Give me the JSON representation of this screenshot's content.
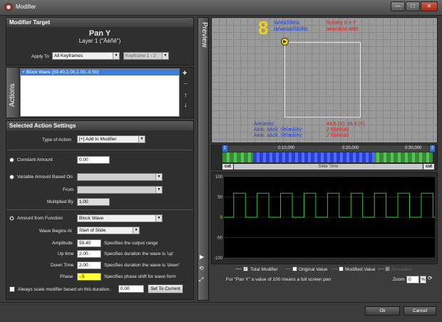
{
  "window": {
    "title": "Modifier",
    "minimize": "—",
    "maximize": "□",
    "close": "✕"
  },
  "modifier_target": {
    "header": "Modifier Target",
    "title": "Pan Y",
    "subtitle": "Layer 1 (\"Äéñê\")",
    "apply_to_label": "Apply To",
    "apply_to_value": "All Keyframes",
    "keyframe_value": "Keyframe 1 - 2"
  },
  "actions": {
    "tab_label": "Actions",
    "items": [
      "+ Block Wave (59.40,2.00,2.00,-0.50)"
    ],
    "add": "+",
    "remove": "−",
    "up": "↑",
    "down": "↓"
  },
  "settings": {
    "header": "Selected Action Settings",
    "type_label": "Type of Action",
    "type_value": "[+] Add to Modifier",
    "constant_label": "Constant Amount",
    "constant_value": "0.00",
    "variable_label": "Variable Amount Based On",
    "variable_value": "",
    "from_label": "From",
    "from_value": "",
    "multiplied_label": "Multiplied By",
    "multiplied_value": "1.00",
    "function_label": "Amount from Function",
    "function_value": "Block Wave",
    "wave_begins_label": "Wave Begins At",
    "wave_begins_value": "Start of Slide",
    "amplitude_label": "Amplitude",
    "amplitude_value": "59.40",
    "amplitude_desc": "Specifies the output range",
    "uptime_label": "Up time",
    "uptime_value": "2.00",
    "uptime_desc": "Specifies duration the wave is 'up'",
    "downtime_label": "Down Time",
    "downtime_value": "2.00",
    "downtime_desc": "Specifies duration the wave is 'down'",
    "phase_label": "Phase",
    "phase_value": "-.5",
    "phase_desc": "Specifies phase shift for wave form",
    "always_scale_label": "Always scale modifier based on this duration.",
    "always_scale_value": "0.00",
    "set_current": "Set To Current"
  },
  "preview": {
    "tab_label": "Preview",
    "number": "8",
    "info_tl_1": "Ìàðêåðîâêà:",
    "info_tl_2": "Ìàñøòàá/Ïîâîðîò:",
    "info_tr_1": "Ïîçèöèÿ X è Y",
    "info_tr_2": "àêòèâíûé áîêñ",
    "info_bl_1": "Àíèìàöèÿ:",
    "info_bl_2": "Äèàï. àâòîì. ïîëîæåíèÿ:",
    "info_bl_3": "Äèàï. àâòîì. ïîëîæåíèÿ:",
    "info_br_1": "44.6 (X): 59.4 (Y)",
    "info_br_2": "2 ñåêóíäû",
    "info_br_3": "2 ñåêóíäû"
  },
  "timeline": {
    "marker_1": "1",
    "marker_2": "2",
    "t1": "0:10,000",
    "t2": "0:20,000",
    "t3": "0:30,000",
    "cut": "cut",
    "slide_time": "Slide Time"
  },
  "graph": {
    "y_ticks": [
      "100",
      "50",
      "0",
      "-50",
      "-100"
    ]
  },
  "legend": {
    "total": "Total Modifier",
    "original": "Original Value",
    "modified": "Modified Value",
    "simulated": "Simulated",
    "note": "For \"Pan Y\" a value of 100 means a full screen pan",
    "zoom_label": "Zoom",
    "zoom_value": "0",
    "zoom_unit": "%"
  },
  "chart_data": {
    "type": "line",
    "title": "",
    "xlabel": "",
    "ylabel": "",
    "ylim": [
      -100,
      100
    ],
    "yticks": [
      100,
      50,
      0,
      -50,
      -100
    ],
    "series": [
      {
        "name": "Total Modifier",
        "color": "#3cd23c",
        "pulses": 9,
        "high": 59.4,
        "low": 0
      }
    ],
    "grid": true
  },
  "footer": {
    "ok": "Ok",
    "cancel": "Cancel"
  }
}
